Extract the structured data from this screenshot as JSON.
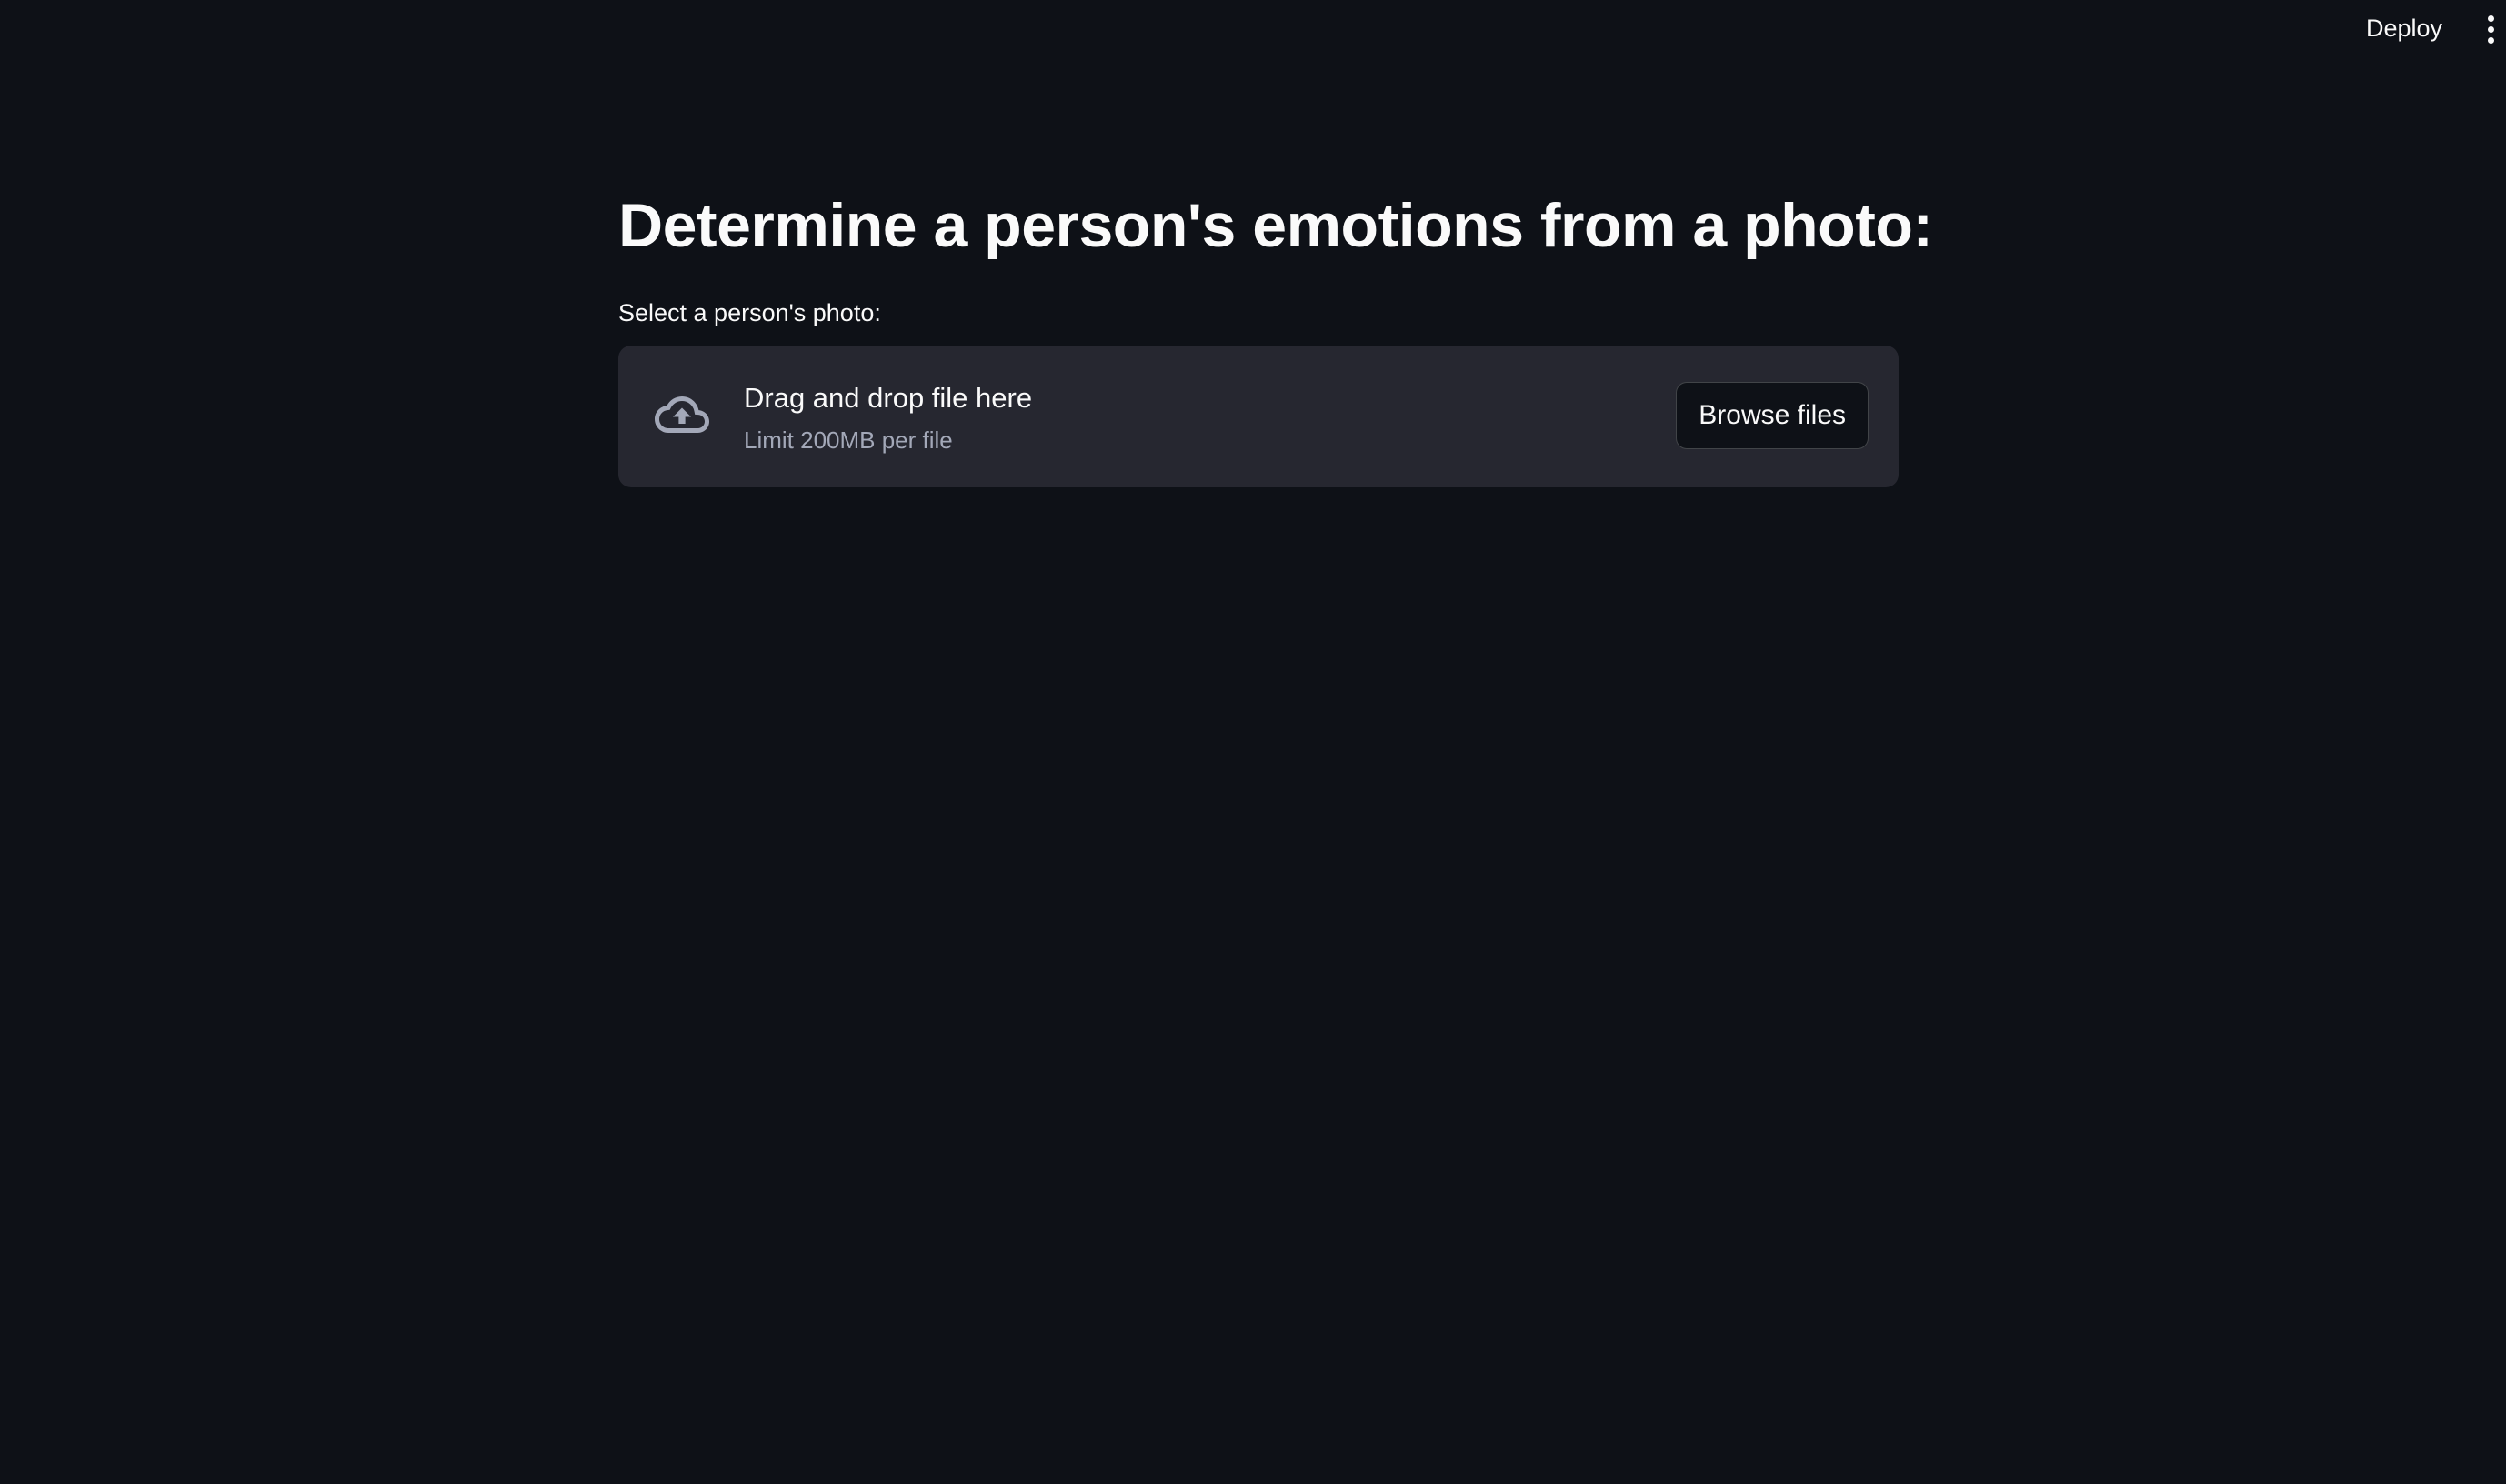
{
  "header": {
    "deploy_label": "Deploy",
    "menu_icon": "vertical-ellipsis-icon"
  },
  "main": {
    "title": "Determine a person's emotions from a photo:",
    "uploader": {
      "label": "Select a person's photo:",
      "instructions": "Drag and drop file here",
      "limit": "Limit 200MB per file",
      "browse_label": "Browse files",
      "icon": "cloud-upload-icon"
    }
  },
  "colors": {
    "background": "#0e1117",
    "dropzone_background": "#262730",
    "text_primary": "#fafafa",
    "text_secondary": "#a3a8b8",
    "icon": "#a3a8b8"
  }
}
